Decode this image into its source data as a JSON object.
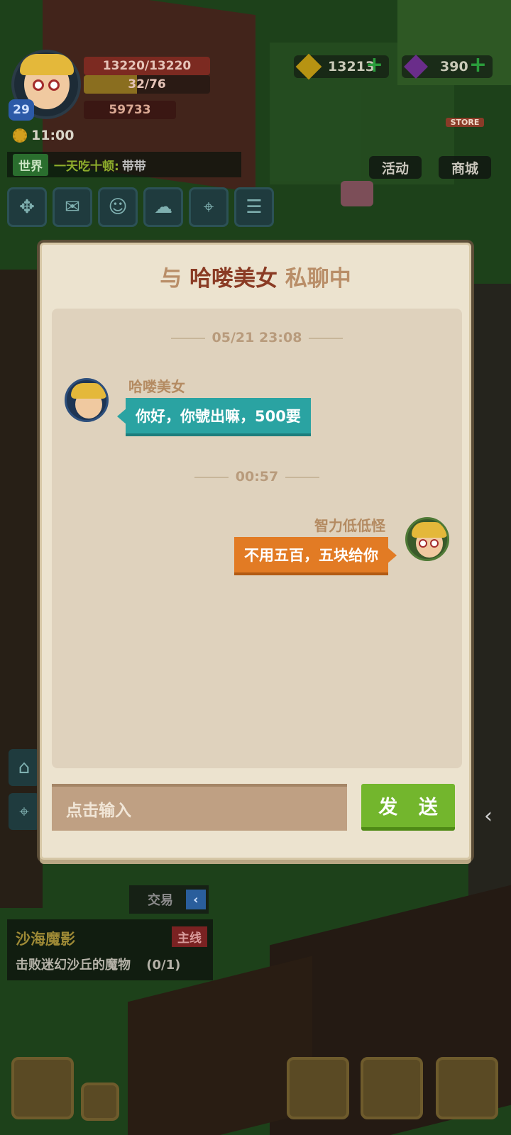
{
  "hud": {
    "level": "29",
    "hp": "13220/13220",
    "exp": "32/76",
    "power": "59733",
    "time": "11:00",
    "coins": "13213",
    "gems": "390",
    "world_chat": {
      "tag": "世界",
      "speaker": "一天吃十顿:",
      "message": "带带"
    },
    "buttons": [
      {
        "icon": "expand-icon"
      },
      {
        "icon": "mail-icon"
      },
      {
        "icon": "friends-icon"
      },
      {
        "icon": "chat-icon"
      },
      {
        "icon": "map-icon"
      },
      {
        "icon": "notice-icon"
      }
    ],
    "shop": {
      "activity": "活动",
      "store": "商城",
      "store_sign": "STORE"
    }
  },
  "quest": {
    "title": "沙海魔影",
    "tag": "主线",
    "description": "击败迷幻沙丘的魔物",
    "progress": "(0/1)",
    "collapse_label": "交易"
  },
  "modal": {
    "title_prefix": "与",
    "title_name": "哈喽美女",
    "title_suffix": "私聊中",
    "messages": [
      {
        "timestamp": "05/21 23:08",
        "sender": "哈喽美女",
        "text": "你好，你號出嘛，500要",
        "side": "left"
      },
      {
        "timestamp": "00:57",
        "sender": "智力低低怪",
        "text": "不用五百，五块给你",
        "side": "right"
      }
    ],
    "input_placeholder": "点击输入",
    "send_label": "发 送"
  },
  "colors": {
    "teal_bubble": "#2aa3a2",
    "orange_bubble": "#e27b24",
    "send_button": "#73b62d",
    "modal_bg": "#ece3cf"
  }
}
